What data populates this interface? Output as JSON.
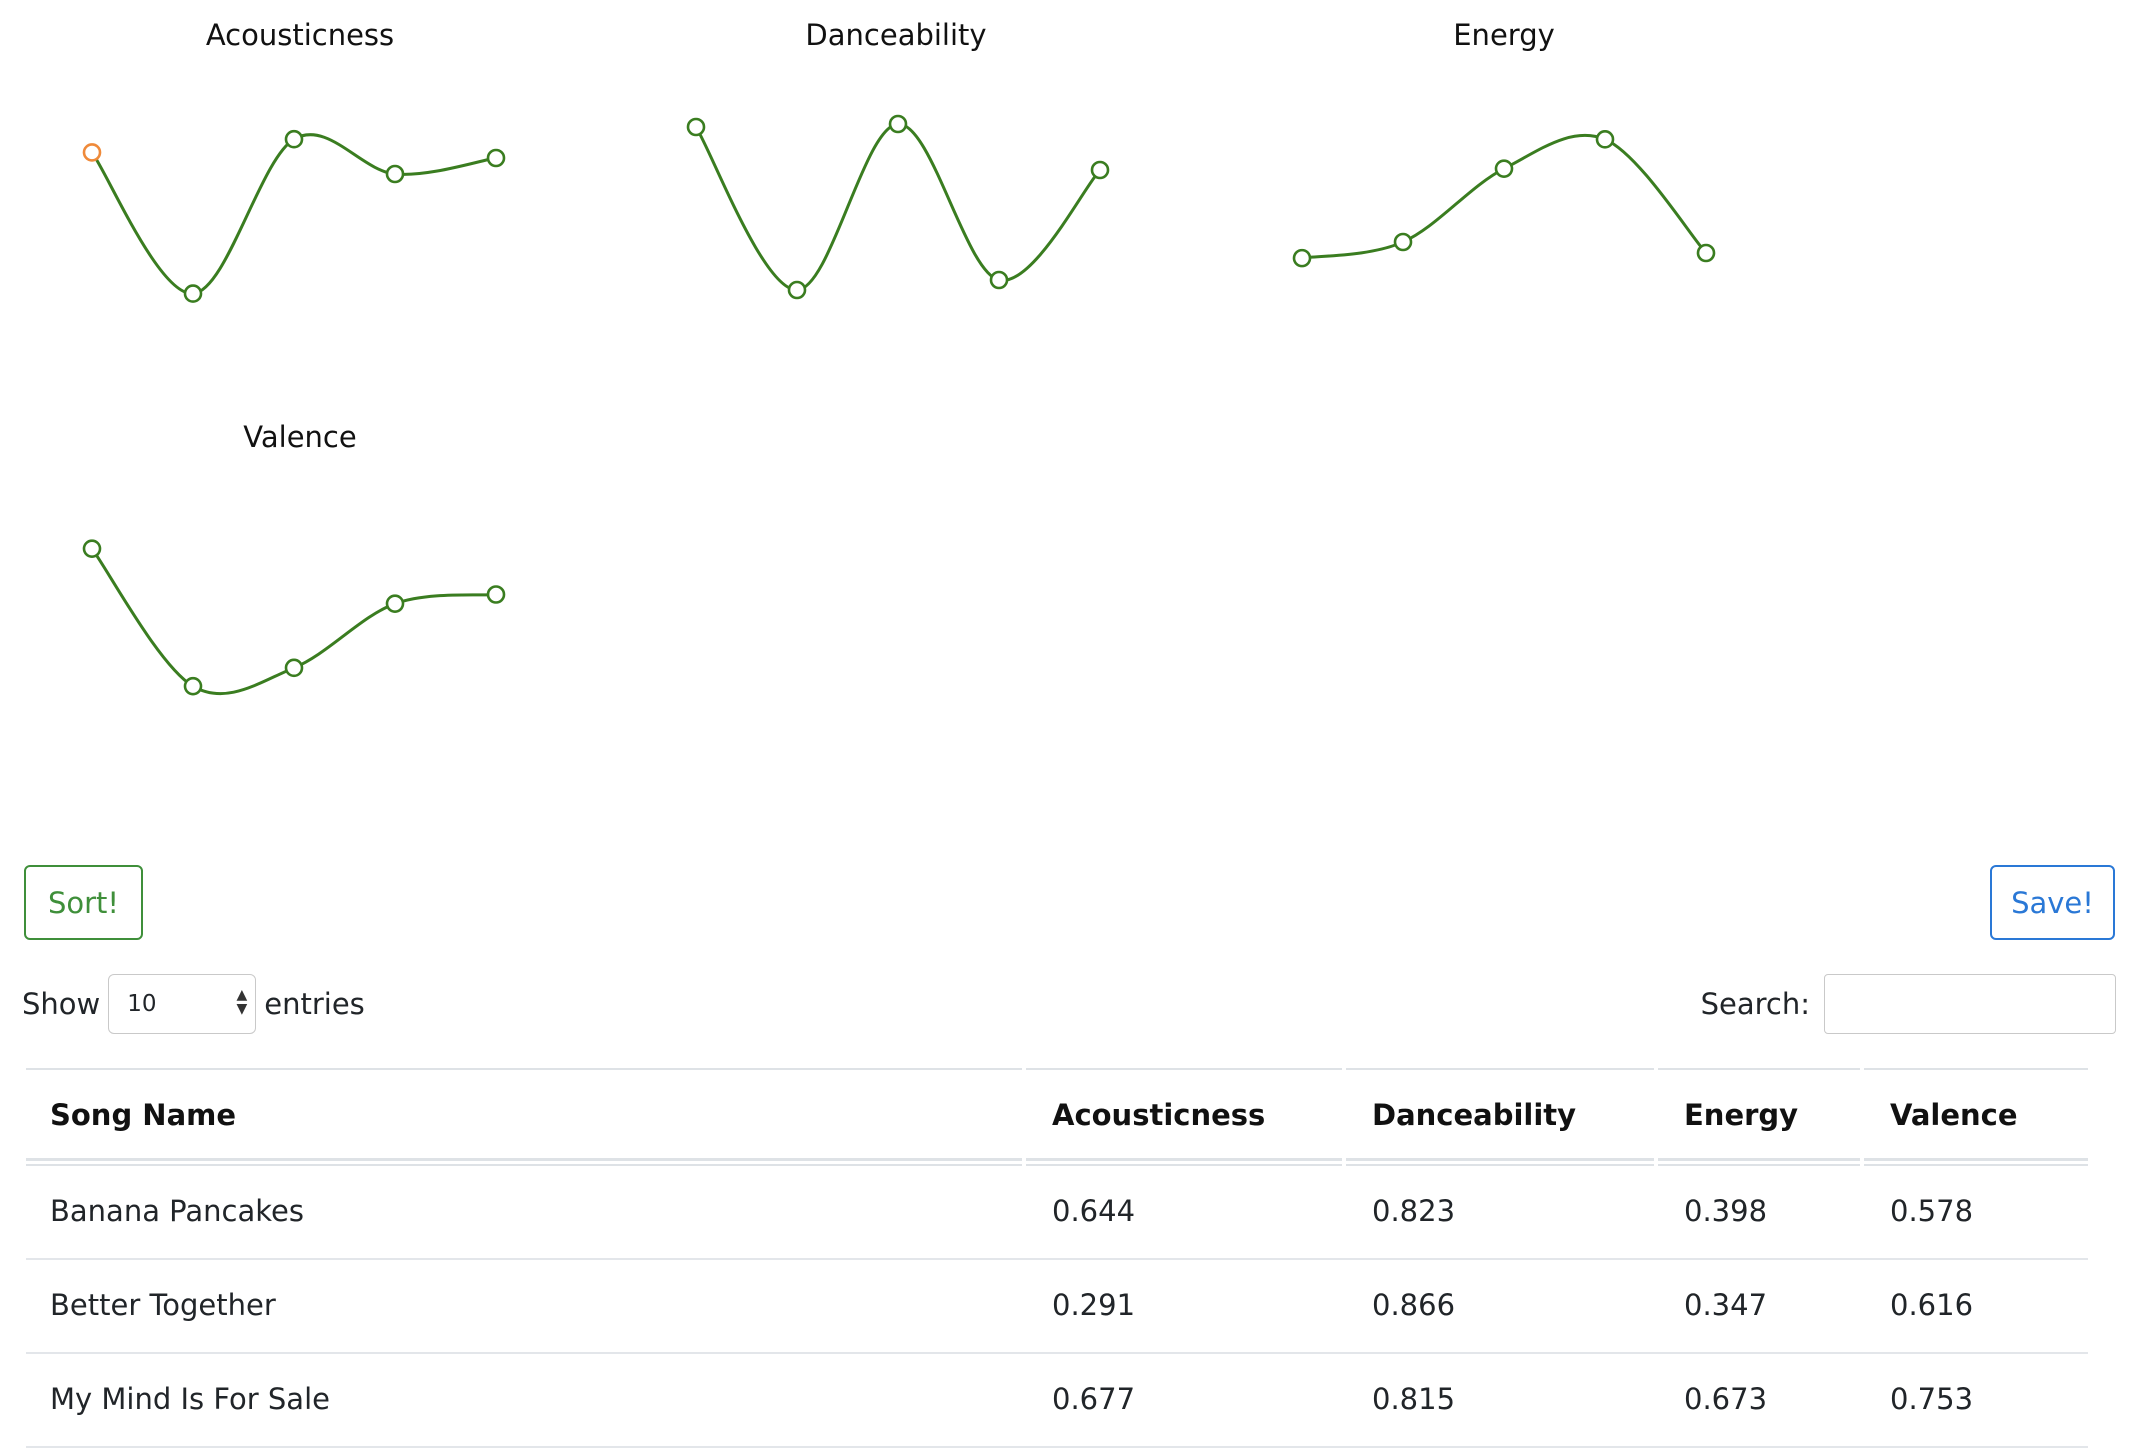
{
  "charts": {
    "acousticness": {
      "title": "Acousticness",
      "values": [
        0.644,
        0.291,
        0.677,
        0.59,
        0.63
      ]
    },
    "danceability": {
      "title": "Danceability",
      "values": [
        0.823,
        0.66,
        0.826,
        0.67,
        0.78
      ]
    },
    "energy": {
      "title": "Energy",
      "values": [
        0.398,
        0.42,
        0.52,
        0.56,
        0.405
      ]
    },
    "valence": {
      "title": "Valence",
      "values": [
        0.66,
        0.51,
        0.53,
        0.6,
        0.61
      ]
    }
  },
  "chart_data": [
    {
      "type": "line",
      "title": "Acousticness",
      "x": [
        1,
        2,
        3,
        4,
        5
      ],
      "series": [
        {
          "values": [
            0.644,
            0.291,
            0.677,
            0.59,
            0.63
          ]
        }
      ]
    },
    {
      "type": "line",
      "title": "Danceability",
      "x": [
        1,
        2,
        3,
        4,
        5
      ],
      "series": [
        {
          "values": [
            0.823,
            0.66,
            0.826,
            0.67,
            0.78
          ]
        }
      ]
    },
    {
      "type": "line",
      "title": "Energy",
      "x": [
        1,
        2,
        3,
        4,
        5
      ],
      "series": [
        {
          "values": [
            0.398,
            0.42,
            0.52,
            0.56,
            0.405
          ]
        }
      ]
    },
    {
      "type": "line",
      "title": "Valence",
      "x": [
        1,
        2,
        3,
        4,
        5
      ],
      "series": [
        {
          "values": [
            0.66,
            0.51,
            0.53,
            0.6,
            0.61
          ]
        }
      ]
    }
  ],
  "colors": {
    "line": "#3a7d20",
    "highlight_point": "#ef8a3a",
    "sort_button": "#3f8f3a",
    "save_button": "#2a78d6"
  },
  "buttons": {
    "sort": "Sort!",
    "save": "Save!"
  },
  "length": {
    "show": "Show",
    "value": "10",
    "entries": "entries"
  },
  "search": {
    "label": "Search:",
    "value": ""
  },
  "table": {
    "headers": [
      "Song Name",
      "Acousticness",
      "Danceability",
      "Energy",
      "Valence"
    ],
    "rows": [
      [
        "Banana Pancakes",
        "0.644",
        "0.823",
        "0.398",
        "0.578"
      ],
      [
        "Better Together",
        "0.291",
        "0.866",
        "0.347",
        "0.616"
      ],
      [
        "My Mind Is For Sale",
        "0.677",
        "0.815",
        "0.673",
        "0.753"
      ]
    ]
  }
}
